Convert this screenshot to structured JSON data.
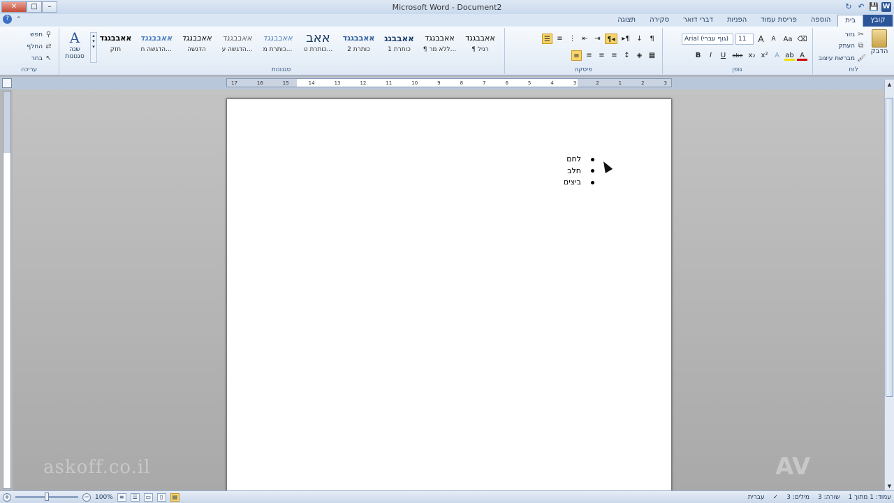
{
  "window": {
    "title": "Microsoft Word  -  Document2",
    "minimize": "–",
    "maximize": "□",
    "close": "✕"
  },
  "qat": {
    "app_icon": "W",
    "save": "💾",
    "undo": "↶",
    "redo": "↻"
  },
  "tabs": [
    {
      "label": "קובץ"
    },
    {
      "label": "בית"
    },
    {
      "label": "הוספה"
    },
    {
      "label": "פריסת עמוד"
    },
    {
      "label": "הפניות"
    },
    {
      "label": "דברי דואר"
    },
    {
      "label": "סקירה"
    },
    {
      "label": "תצוגה"
    }
  ],
  "ribbon": {
    "clipboard": {
      "group_label": "לוח",
      "paste": "הדבק",
      "cut": "גזור",
      "copy": "העתק",
      "format_painter": "מברשת עיצוב"
    },
    "font": {
      "group_label": "גופן",
      "font_name": "Arial (גוף עברי)",
      "font_size": "11",
      "grow": "A",
      "shrink": "A",
      "case": "Aa",
      "bold": "B",
      "italic": "I",
      "underline": "U",
      "strike": "abe",
      "subscript": "x₂",
      "superscript": "x²",
      "effects": "A",
      "highlight": "ab",
      "color": "A"
    },
    "paragraph": {
      "group_label": "פיסקה",
      "show_marks": "¶",
      "sort": "↓",
      "rtl": "¶◂",
      "ltr": "▸¶"
    },
    "styles": {
      "group_label": "סגנונות",
      "change_styles": "שנה סגנונות",
      "items": [
        {
          "sample": "אאבבגגד",
          "name": "¶ רגיל"
        },
        {
          "sample": "אאבבגגד",
          "name": "¶ ללא מר..."
        },
        {
          "sample": "אאבבגג",
          "name": "כותרת 1"
        },
        {
          "sample": "אאבבגגד",
          "name": "כותרת 2"
        },
        {
          "sample": "אאב",
          "name": "כותרת ט..."
        },
        {
          "sample": "אאבבגגד",
          "name": "כותרת מ..."
        },
        {
          "sample": "אאבבגגד",
          "name": "הדגשה ע..."
        },
        {
          "sample": "אאבבגגד",
          "name": "הדגשה"
        },
        {
          "sample": "אאבבגגד",
          "name": "הדגשה ח..."
        },
        {
          "sample": "אאבבגגד",
          "name": "חזק"
        }
      ]
    },
    "editing": {
      "group_label": "עריכה",
      "find": "חפש",
      "replace": "החלף",
      "select": "בחר"
    }
  },
  "ruler": {
    "ticks": [
      "3",
      "2",
      "1",
      "2",
      "3",
      "4",
      "5",
      "6",
      "7",
      "8",
      "9",
      "10",
      "11",
      "12",
      "13",
      "14",
      "15",
      "16",
      "17"
    ]
  },
  "document": {
    "bullets": [
      "לחם",
      "חלב",
      "ביצים"
    ]
  },
  "watermarks": {
    "left": "askoff.co.il",
    "right": "AV"
  },
  "status": {
    "page": "עמוד: 1 מתוך 1",
    "line": "שורה: 3",
    "words": "מילים: 3",
    "language": "עברית",
    "zoom": "100%"
  }
}
